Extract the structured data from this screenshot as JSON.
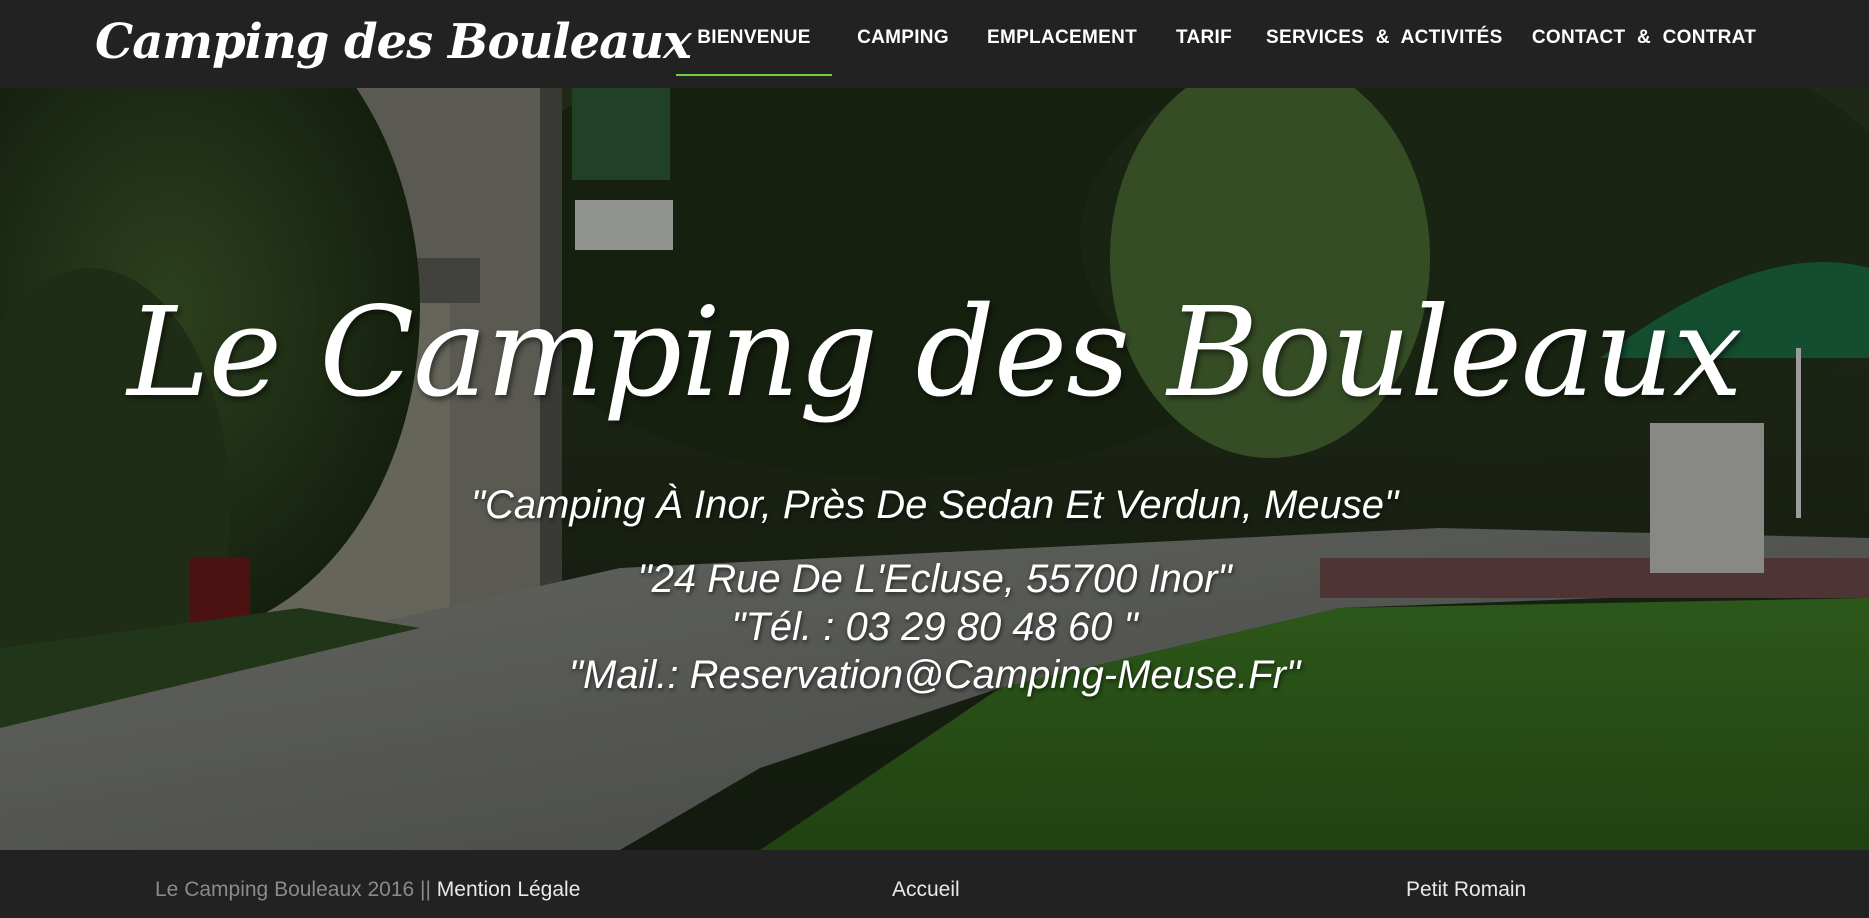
{
  "brand": "Camping des Bouleaux",
  "nav": {
    "items": [
      {
        "label": "BIENVENUE",
        "active": true
      },
      {
        "label": "CAMPING",
        "active": false
      },
      {
        "label": "EMPLACEMENT",
        "active": false
      },
      {
        "label": "TARIF",
        "active": false
      },
      {
        "label": "SERVICES & ACTIVITÉS",
        "active": false
      },
      {
        "label": "CONTACT & CONTRAT",
        "active": false
      }
    ],
    "active_color": "#6fcf3c"
  },
  "hero": {
    "title": "Le Camping des Bouleaux",
    "subtitle": "\"Camping À Inor, Près De Sedan Et Verdun, Meuse\"",
    "address": "\"24 Rue De L'Ecluse, 55700 Inor\"",
    "phone": "\"Tél. : 03 29 80 48 60 \"",
    "mail": "\"Mail.: Reservation@Camping-Meuse.Fr\""
  },
  "footer": {
    "copyright": "Le Camping Bouleaux 2016 ||",
    "legal_link": "Mention Légale",
    "home_link": "Accueil",
    "author": "Petit Romain"
  }
}
